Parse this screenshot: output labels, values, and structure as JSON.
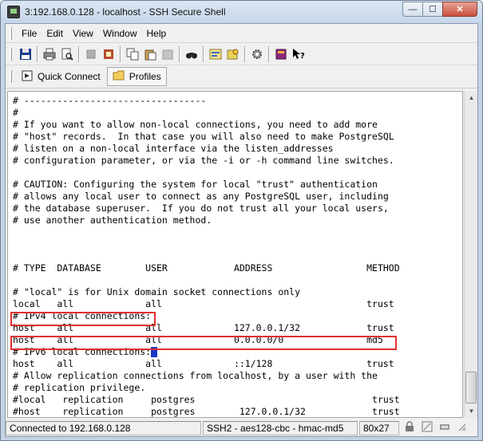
{
  "window": {
    "title": "3:192.168.0.128 - localhost - SSH Secure Shell",
    "min_glyph": "—",
    "max_glyph": "☐",
    "close_glyph": "✕"
  },
  "menu": [
    "File",
    "Edit",
    "View",
    "Window",
    "Help"
  ],
  "toolbar_icons": [
    "save-icon",
    "print-icon",
    "print-preview-icon",
    "disabled-icon",
    "paste-icon",
    "copy-icon",
    "paste-alt-icon",
    "disabled-alt-icon",
    "find-icon",
    "settings-icon",
    "key-icon",
    "gear-icon",
    "book-icon",
    "context-help-icon"
  ],
  "quickbar": {
    "quick_connect": "Quick Connect",
    "profiles": "Profiles"
  },
  "terminal": {
    "lines": [
      "# ---------------------------------",
      "#",
      "# If you want to allow non-local connections, you need to add more",
      "# \"host\" records.  In that case you will also need to make PostgreSQL",
      "# listen on a non-local interface via the listen_addresses",
      "# configuration parameter, or via the -i or -h command line switches.",
      "",
      "# CAUTION: Configuring the system for local \"trust\" authentication",
      "# allows any local user to connect as any PostgreSQL user, including",
      "# the database superuser.  If you do not trust all your local users,",
      "# use another authentication method.",
      "",
      "",
      "",
      "# TYPE  DATABASE        USER            ADDRESS                 METHOD",
      "",
      "# \"local\" is for Unix domain socket connections only",
      "local   all             all                                     trust",
      "# IPv4 local connections:",
      "host    all             all             127.0.0.1/32            trust",
      "host    all             all             0.0.0.0/0               md5",
      "# IPv6 local connections:",
      "host    all             all             ::1/128                 trust",
      "# Allow replication connections from localhost, by a user with the",
      "# replication privilege.",
      "#local   replication     postgres                                trust",
      "#host    replication     postgres        127.0.0.1/32            trust"
    ]
  },
  "status": {
    "connection": "Connected to 192.168.0.128",
    "cipher": "SSH2 - aes128-cbc - hmac-md5",
    "size": "80x27"
  },
  "colors": {
    "highlight": "#e03030",
    "cursor": "#1a37c8"
  }
}
